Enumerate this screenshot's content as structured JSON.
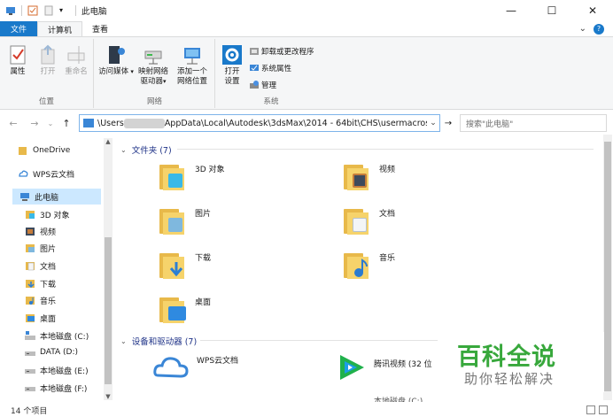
{
  "window": {
    "title": "此电脑",
    "minimize": "—",
    "maximize": "☐",
    "close": "✕"
  },
  "ribbon_tabs": [
    "文件",
    "计算机",
    "查看"
  ],
  "ribbon": {
    "location_group": {
      "label": "位置",
      "properties": "属性",
      "open": "打开",
      "rename": "重命名"
    },
    "network_group": {
      "label": "网络",
      "access_media_1": "访问媒体",
      "map_drive_1": "映射网络",
      "map_drive_2": "驱动器",
      "add_location_1": "添加一个",
      "add_location_2": "网络位置"
    },
    "system_group": {
      "label": "系统",
      "open_settings_1": "打开",
      "open_settings_2": "设置",
      "uninstall": "卸载或更改程序",
      "system_props": "系统属性",
      "manage": "管理"
    }
  },
  "address": {
    "path_prefix": "\\Users",
    "path_suffix": "AppData\\Local\\Autodesk\\3dsMax\\2014 - 64bit\\CHS\\usermacros",
    "search_placeholder": "搜索\"此电脑\""
  },
  "sidebar": {
    "items": [
      {
        "label": "OneDrive",
        "icon": "cloud-icon"
      },
      {
        "label": "WPS云文档",
        "icon": "wps-cloud-icon"
      },
      {
        "label": "此电脑",
        "icon": "computer-icon"
      },
      {
        "label": "3D 对象",
        "icon": "3d-objects-icon"
      },
      {
        "label": "视频",
        "icon": "videos-icon"
      },
      {
        "label": "图片",
        "icon": "pictures-icon"
      },
      {
        "label": "文档",
        "icon": "documents-icon"
      },
      {
        "label": "下载",
        "icon": "downloads-icon"
      },
      {
        "label": "音乐",
        "icon": "music-icon"
      },
      {
        "label": "桌面",
        "icon": "desktop-icon"
      },
      {
        "label": "本地磁盘 (C:)",
        "icon": "drive-icon"
      },
      {
        "label": "DATA (D:)",
        "icon": "drive-icon"
      },
      {
        "label": "本地磁盘 (E:)",
        "icon": "drive-icon"
      },
      {
        "label": "本地磁盘 (F:)",
        "icon": "drive-icon"
      }
    ]
  },
  "content": {
    "folders_header": "文件夹 (7)",
    "folders": [
      {
        "label": "3D 对象",
        "icon": "3d-objects-folder-icon",
        "accent": "#39b9e8"
      },
      {
        "label": "视频",
        "icon": "videos-folder-icon",
        "accent": "#3d4a5c"
      },
      {
        "label": "图片",
        "icon": "pictures-folder-icon",
        "accent": "#7fb8de"
      },
      {
        "label": "文档",
        "icon": "documents-folder-icon",
        "accent": "#e9eef3"
      },
      {
        "label": "下载",
        "icon": "downloads-folder-icon",
        "accent": "#2d7fd3"
      },
      {
        "label": "音乐",
        "icon": "music-folder-icon",
        "accent": "#2b7bd0"
      },
      {
        "label": "桌面",
        "icon": "desktop-folder-icon",
        "accent": "#2f8ae0"
      }
    ],
    "devices_header": "设备和驱动器 (7)",
    "devices": [
      {
        "label": "WPS云文档",
        "icon": "wps-cloud-icon"
      },
      {
        "label": "腾讯视频 (32 位",
        "icon": "tencent-video-icon"
      },
      {
        "label": "本地磁盘 (C:)",
        "icon": "drive-icon"
      }
    ]
  },
  "status": {
    "item_count": "14 个项目"
  },
  "watermark": {
    "title": "百科全说",
    "subtitle": "助你轻松解决"
  }
}
